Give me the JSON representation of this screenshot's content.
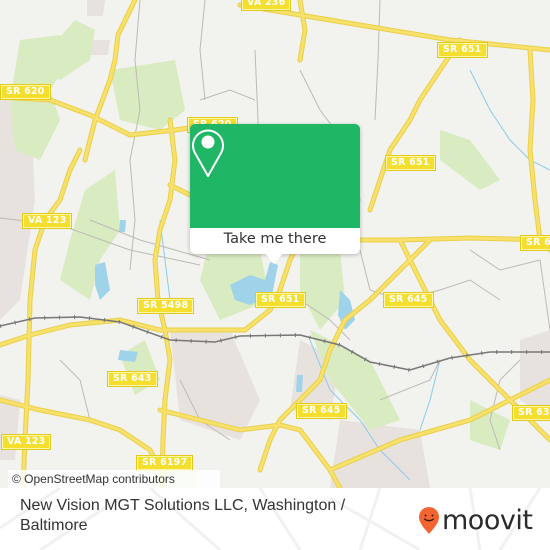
{
  "map": {
    "attribution": "© OpenStreetMap contributors",
    "route_labels": [
      {
        "id": "va236",
        "text": "VA 236"
      },
      {
        "id": "sr651-top",
        "text": "SR 651"
      },
      {
        "id": "sr620-left",
        "text": "SR 620"
      },
      {
        "id": "sr620-mid",
        "text": "SR 620"
      },
      {
        "id": "sr651-mid",
        "text": "SR 651"
      },
      {
        "id": "va123-top",
        "text": "VA 123"
      },
      {
        "id": "sr6-right",
        "text": "SR 6"
      },
      {
        "id": "sr5498",
        "text": "SR 5498"
      },
      {
        "id": "sr651-low",
        "text": "SR 651"
      },
      {
        "id": "sr645-top",
        "text": "SR 645"
      },
      {
        "id": "sr643",
        "text": "SR 643"
      },
      {
        "id": "sr645-low",
        "text": "SR 645"
      },
      {
        "id": "sr63",
        "text": "SR 63"
      },
      {
        "id": "va123-bottom",
        "text": "VA 123"
      },
      {
        "id": "sr6197",
        "text": "SR 6197"
      }
    ],
    "colors": {
      "background": "#f2f2ef",
      "road": "#f7e16a",
      "park": "#d9ebc0",
      "water": "#9fd3ea",
      "residential": "#e8e2df",
      "rail": "#777777"
    }
  },
  "popup": {
    "pin_icon": "map-pin-icon",
    "button_label": "Take me there",
    "color": "#1fb765"
  },
  "footer": {
    "title": "New Vision MGT Solutions LLC, Washington / Baltimore",
    "brand": "moovit",
    "brand_color": "#f26430"
  }
}
